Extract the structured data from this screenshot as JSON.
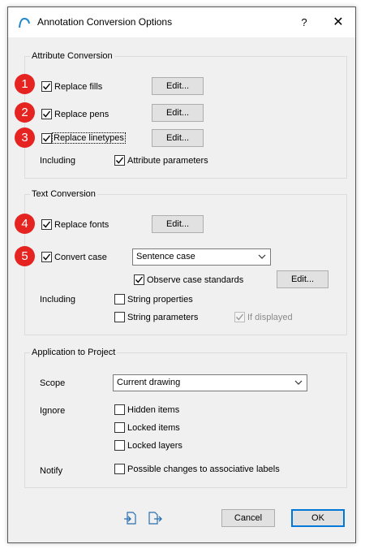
{
  "window": {
    "title": "Annotation Conversion Options",
    "help_label": "?",
    "close_label": "✕"
  },
  "attribute_conversion": {
    "title": "Attribute Conversion",
    "replace_fills": "Replace fills",
    "replace_pens": "Replace pens",
    "replace_linetypes": "Replace linetypes",
    "including_label": "Including",
    "attribute_parameters": "Attribute parameters",
    "edit_label": "Edit..."
  },
  "text_conversion": {
    "title": "Text Conversion",
    "replace_fonts": "Replace fonts",
    "convert_case": "Convert case",
    "case_selected": "Sentence case",
    "observe_case_standards": "Observe case standards",
    "including_label": "Including",
    "string_properties": "String properties",
    "string_parameters": "String parameters",
    "if_displayed": "If displayed",
    "edit_label": "Edit..."
  },
  "application": {
    "title": "Application to Project",
    "scope_label": "Scope",
    "scope_selected": "Current drawing",
    "ignore_label": "Ignore",
    "hidden_items": "Hidden items",
    "locked_items": "Locked items",
    "locked_layers": "Locked layers",
    "notify_label": "Notify",
    "possible_changes": "Possible changes to associative labels"
  },
  "footer": {
    "cancel_label": "Cancel",
    "ok_label": "OK",
    "import_icon": "import-icon",
    "export_icon": "export-icon"
  },
  "badges": [
    "1",
    "2",
    "3",
    "4",
    "5"
  ],
  "colors": {
    "badge": "#e52421",
    "accent": "#0078d7",
    "dialog_bg": "#f0f0f0"
  }
}
